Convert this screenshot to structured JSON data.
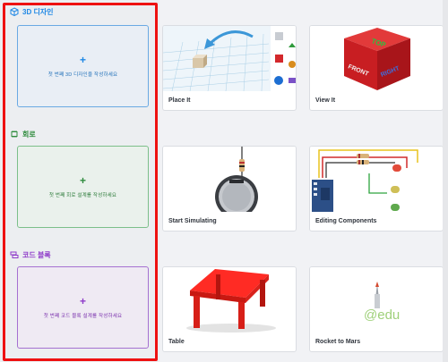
{
  "sections": [
    {
      "title": "3D 디자인",
      "color": "#1f88e5",
      "create_text": "첫 번째 3D 디자인을 작성하세요",
      "card_bg": "#e9eef5"
    },
    {
      "title": "회로",
      "color": "#2e8b3d",
      "create_text": "첫 번째 회로 설계를 작성하세요",
      "card_bg": "#eaf1ec"
    },
    {
      "title": "코드 블록",
      "color": "#8e3bc9",
      "create_text": "첫 번째 코드 블록 설계를 작성하세요",
      "card_bg": "#efeaf3"
    }
  ],
  "tiles": [
    {
      "label": "Place It"
    },
    {
      "label": "View It"
    },
    {
      "label": "Start Simulating"
    },
    {
      "label": "Editing Components"
    },
    {
      "label": "Table"
    },
    {
      "label": "Rocket to Mars"
    }
  ],
  "thumb_text": {
    "top": "TOP",
    "front": "FRONT",
    "right": "RIGHT",
    "edu": "@edu"
  }
}
